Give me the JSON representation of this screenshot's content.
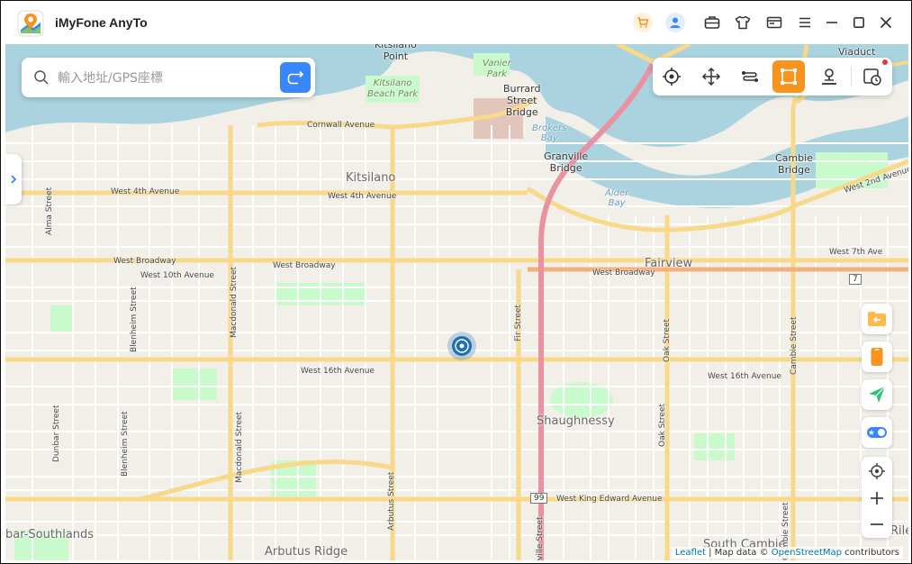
{
  "app": {
    "title": "iMyFone AnyTo"
  },
  "titlebar": {
    "icons": [
      "cart-icon",
      "user-icon",
      "toolbox-icon",
      "tshirt-icon",
      "mail-icon",
      "menu-icon",
      "minimize-icon",
      "maximize-icon",
      "close-icon"
    ]
  },
  "search": {
    "placeholder": "輸入地址/GPS座標"
  },
  "toolbar": {
    "tools": [
      "teleport-mode",
      "joystick-mode",
      "two-spot-mode",
      "multi-spot-mode",
      "jump-teleport-mode",
      "history"
    ],
    "active": "multi-spot-mode"
  },
  "map": {
    "labels": {
      "kitsilano_point": "Kitsilano\nPoint",
      "vanier_park": "Vanier\nPark",
      "kits_beach_park": "Kitsilano\nBeach Park",
      "burrard_bridge": "Burrard\nStreet\nBridge",
      "granville_bridge": "Granville\nBridge",
      "cambie_bridge": "Cambie\nBridge",
      "brokers_bay": "Brokers\nBay",
      "alder_bay": "Alder\nBay",
      "viaduct": "Viaduct",
      "cornwall": "Cornwall Avenue",
      "kitsilano": "Kitsilano",
      "w4th_1": "West 4th Avenue",
      "w4th_2": "West 4th Avenue",
      "w2nd": "West 2nd Avenue",
      "w7th": "West 7th Ave",
      "broadway_1": "West Broadway",
      "broadway_2": "West Broadway",
      "broadway_3": "West Broadway",
      "w10th": "West 10th Avenue",
      "fairview": "Fairview",
      "w16th_1": "West 16th Avenue",
      "w16th_2": "West 16th Avenue",
      "shaughnessy": "Shaughnessy",
      "king_edward": "West King Edward Avenue",
      "south_cambie": "South Cambie",
      "arbutus_ridge": "Arbutus Ridge",
      "dunbar_southlands": "bar-Southlands",
      "alma": "Alma Street",
      "blenheim_1": "Blenheim Street",
      "blenheim_2": "Blenheim Street",
      "macdonald_1": "Macdonald Street",
      "macdonald_2": "Macdonald Street",
      "dunbar": "Dunbar Street",
      "arbutus": "Arbutus Street",
      "fir": "Fir Street",
      "oak_1": "Oak Street",
      "oak_2": "Oak Street",
      "cambie_1": "Cambie Street",
      "cambie_2": "Cambie Street",
      "granville_st": "ville Street",
      "rile": "Rile",
      "hwy_99": "99",
      "hwy_7": "7"
    }
  },
  "right_controls": [
    "import-file",
    "device",
    "send-location",
    "toggle",
    "locate",
    "zoom-in",
    "zoom-out"
  ],
  "attribution": {
    "leaflet": "Leaflet",
    "sep": " | Map data © ",
    "osm": "OpenStreetMap",
    "tail": " contributors"
  },
  "colors": {
    "accent": "#f7941d",
    "search_button": "#3a86ff",
    "pin": "#1e6fb5",
    "water": "#aad3df",
    "park": "#c8facc",
    "major_road": "#f8d98a",
    "motorway": "#e892a2"
  }
}
